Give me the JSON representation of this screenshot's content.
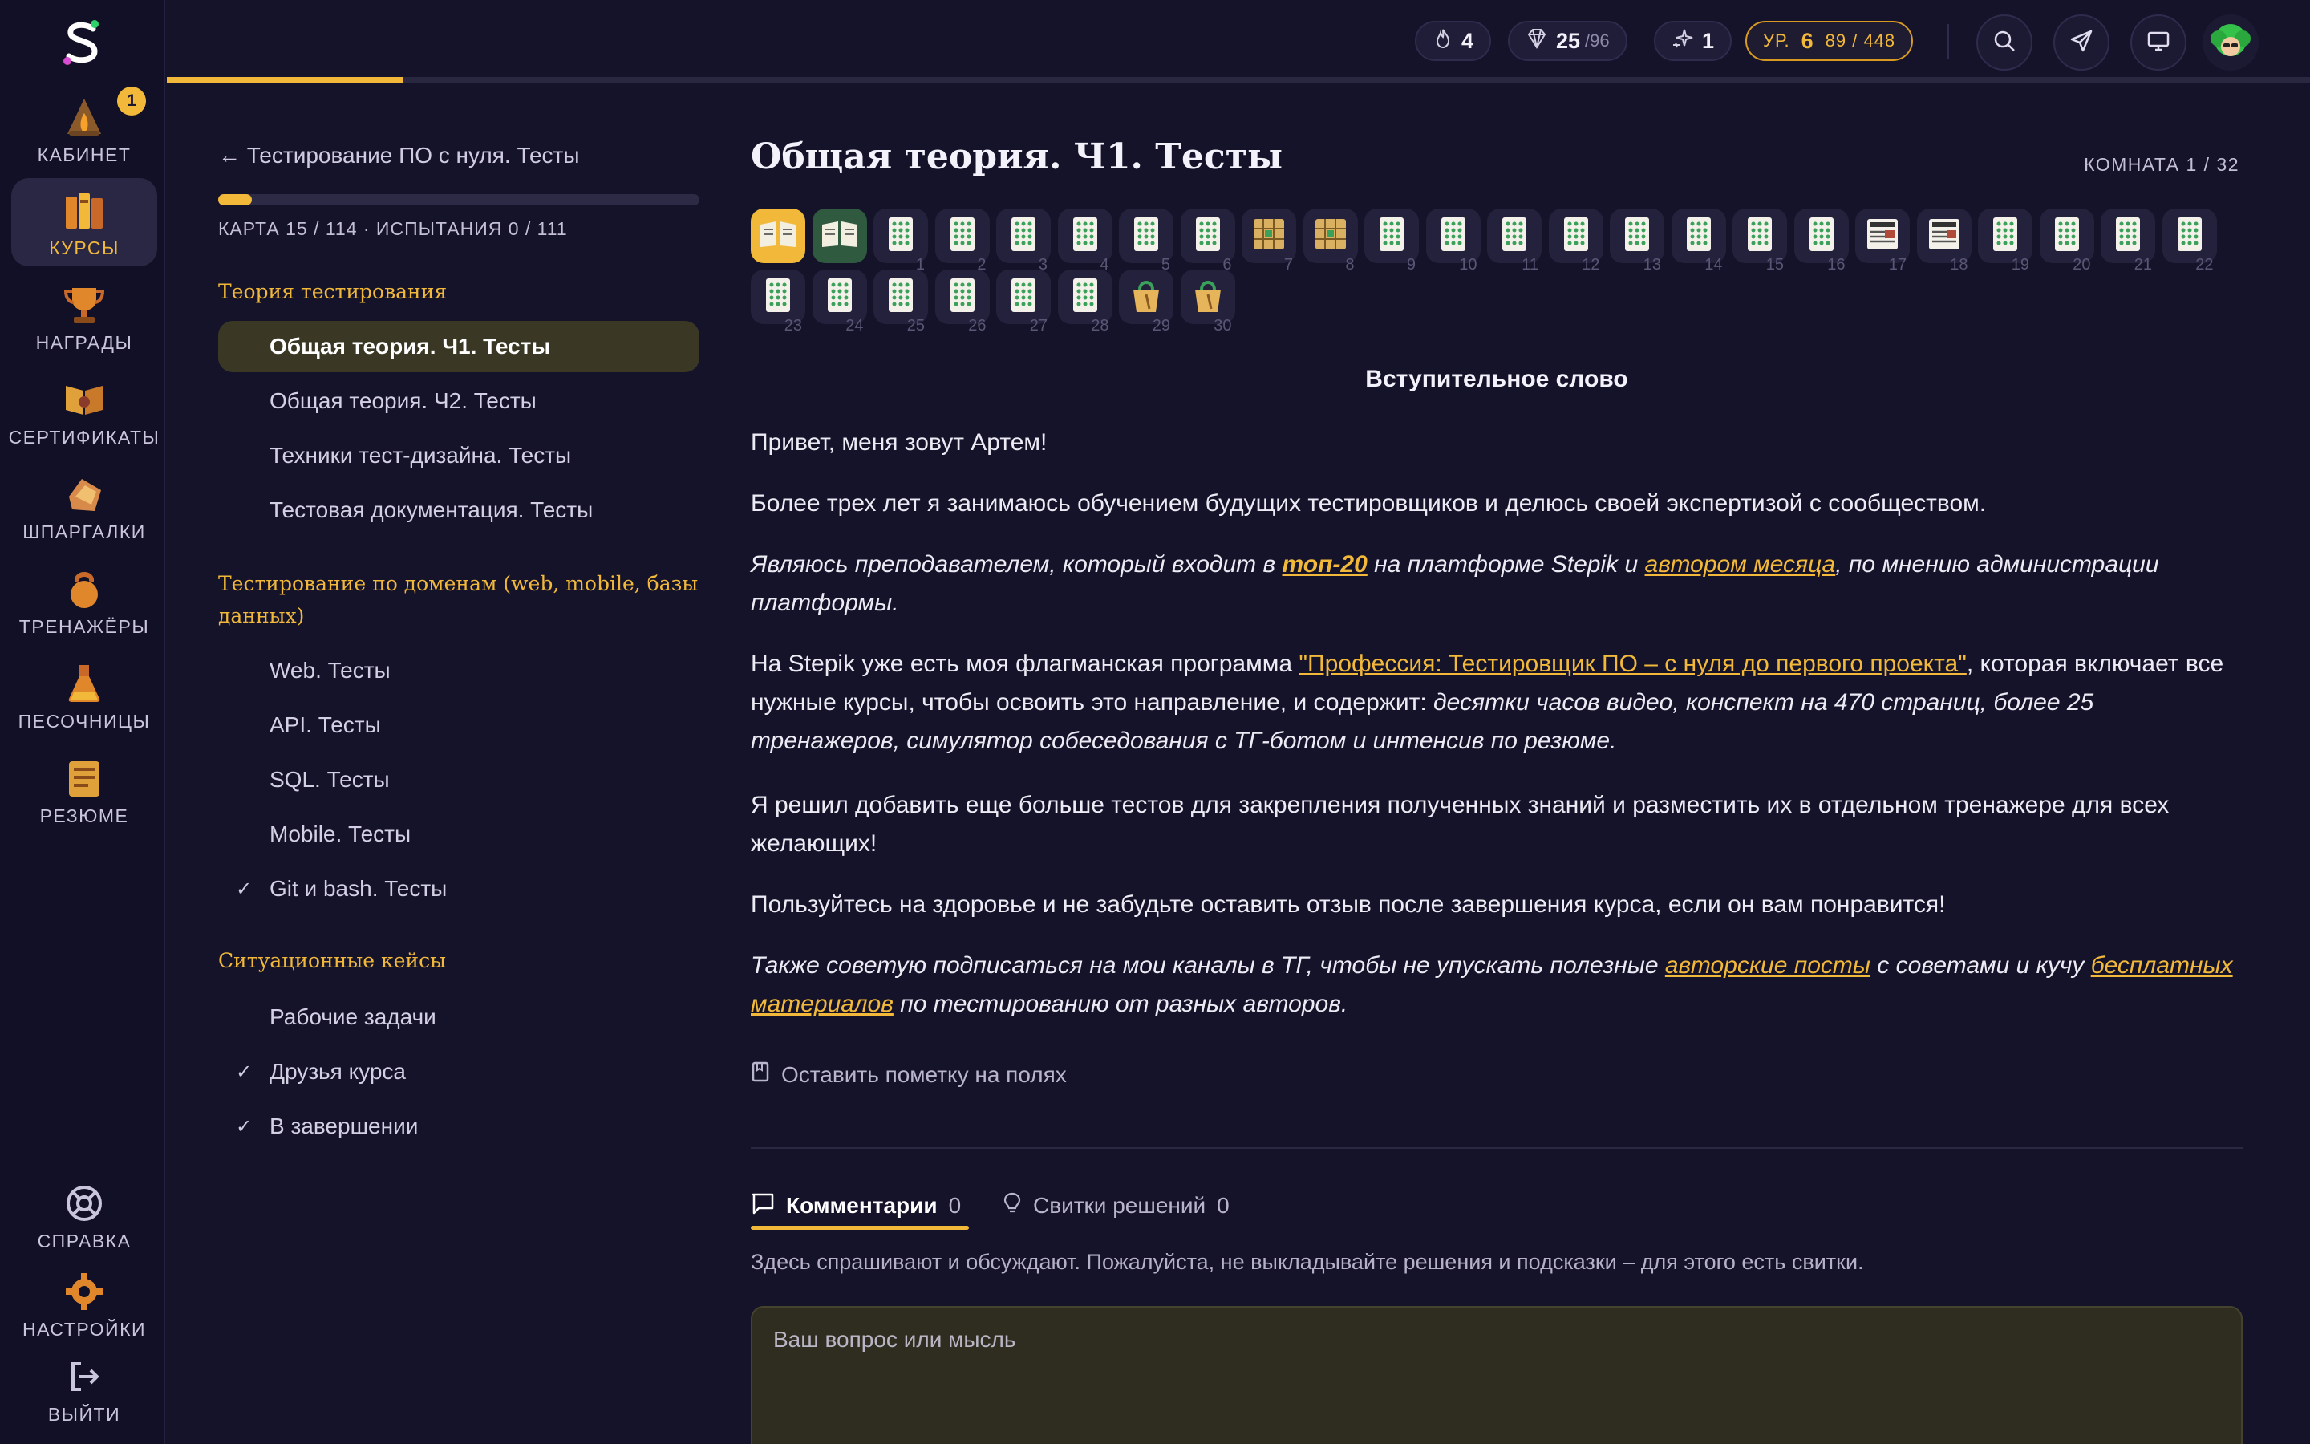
{
  "rail": {
    "items": [
      {
        "label": "Кабинет",
        "icon": "campfire-icon",
        "badge": "1"
      },
      {
        "label": "Курсы",
        "icon": "books-icon",
        "active": true
      },
      {
        "label": "Награды",
        "icon": "trophy-icon"
      },
      {
        "label": "Сертификаты",
        "icon": "certificate-icon"
      },
      {
        "label": "Шпаргалки",
        "icon": "cheatsheet-icon"
      },
      {
        "label": "Тренажёры",
        "icon": "kettlebell-icon"
      },
      {
        "label": "Песочницы",
        "icon": "flask-icon"
      },
      {
        "label": "Резюме",
        "icon": "resume-icon"
      }
    ],
    "bottom": [
      {
        "label": "Справка",
        "icon": "lifebuoy-icon"
      },
      {
        "label": "Настройки",
        "icon": "gear-icon"
      },
      {
        "label": "Выйти",
        "icon": "logout-icon"
      }
    ]
  },
  "topbar": {
    "streak": "4",
    "gems": "25",
    "gems_total": "/96",
    "boosts": "1",
    "level_prefix": "УР.",
    "level": "6",
    "xp": "89 / 448",
    "progress_fraction": 0.11
  },
  "course": {
    "back": "← Тестирование ПО с нуля. Тесты",
    "stats": "КАРТА 15 / 114 · ИСПЫТАНИЯ 0 / 111",
    "progress_fraction": 0.07,
    "sections": [
      {
        "title": "Теория тестирования",
        "items": [
          {
            "label": "Общая теория. Ч1. Тесты",
            "active": true,
            "done": false
          },
          {
            "label": "Общая теория. Ч2. Тесты",
            "done": false
          },
          {
            "label": "Техники тест-дизайна. Тесты",
            "done": false
          },
          {
            "label": "Тестовая документация. Тесты",
            "done": false
          }
        ]
      },
      {
        "title": "Тестирование по доменам (web, mobile, базы данных)",
        "items": [
          {
            "label": "Web. Тесты",
            "done": false
          },
          {
            "label": "API. Тесты",
            "done": false
          },
          {
            "label": "SQL. Тесты",
            "done": false
          },
          {
            "label": "Mobile. Тесты",
            "done": false
          },
          {
            "label": "Git и bash. Тесты",
            "done": true
          }
        ]
      },
      {
        "title": "Ситуационные кейсы",
        "items": [
          {
            "label": "Рабочие задачи",
            "done": false
          },
          {
            "label": "Друзья курса",
            "done": true
          },
          {
            "label": "В завершении",
            "done": true
          }
        ]
      }
    ]
  },
  "main": {
    "title": "Общая теория. Ч1. Тесты",
    "room": "КОМНАТА 1 / 32",
    "steps_row1": [
      "",
      "",
      "1",
      "2",
      "3",
      "4",
      "5",
      "6",
      "7",
      "8",
      "9",
      "10",
      "11",
      "12",
      "13",
      "14",
      "15",
      "16",
      "17",
      "18",
      "19",
      "20",
      "21",
      "22"
    ],
    "steps_row2": [
      "23",
      "24",
      "25",
      "26",
      "27",
      "28",
      "29",
      "30"
    ],
    "heading": "Вступительное слово",
    "p1": "Привет, меня зовут Артем!",
    "p2": "Более трех лет я занимаюсь обучением будущих тестировщиков и делюсь своей экспертизой с сообществом.",
    "p3_a": "Являюсь преподавателем, который входит в ",
    "p3_link1": "топ-20",
    "p3_b": " на платформе Stepik и ",
    "p3_link2": "автором месяца",
    "p3_c": ", по мнению администрации платформы.",
    "p4_a": "На Stepik уже есть моя флагманская программа ",
    "p4_link": "\"Профессия: Тестировщик ПО – с нуля до первого проекта\"",
    "p4_b": ", которая включает все нужные курсы, чтобы освоить это направление, и содержит: ",
    "p4_c": "десятки часов видео, конспект на 470 страниц, более 25 тренажеров, симулятор собеседования с ТГ-ботом и интенсив по резюме.",
    "p5": "Я решил добавить еще больше тестов для закрепления полученных знаний и разместить их в отдельном тренажере для всех желающих!",
    "p6": "Пользуйтесь на здоровье и не забудьте оставить отзыв после завершения курса, если он вам понравится!",
    "p7_a": "Также советую подписаться на мои каналы в ТГ, чтобы не упускать полезные ",
    "p7_link1": "авторские посты",
    "p7_b": " с советами и кучу ",
    "p7_link2": "бесплатных материалов",
    "p7_c": " по тестированию от разных авторов.",
    "margin_note": "Оставить пометку на полях",
    "tabs": [
      {
        "label": "Комментарии",
        "count": "0",
        "active": true
      },
      {
        "label": "Свитки решений",
        "count": "0"
      }
    ],
    "comment_hint": "Здесь спрашивают и обсуждают. Пожалуйста, не выкладывайте решения и подсказки – для этого есть свитки.",
    "comment_placeholder": "Ваш вопрос или мысль"
  },
  "colors": {
    "accent": "#f1b83a",
    "bg": "#15132a",
    "rail": "#121026"
  }
}
